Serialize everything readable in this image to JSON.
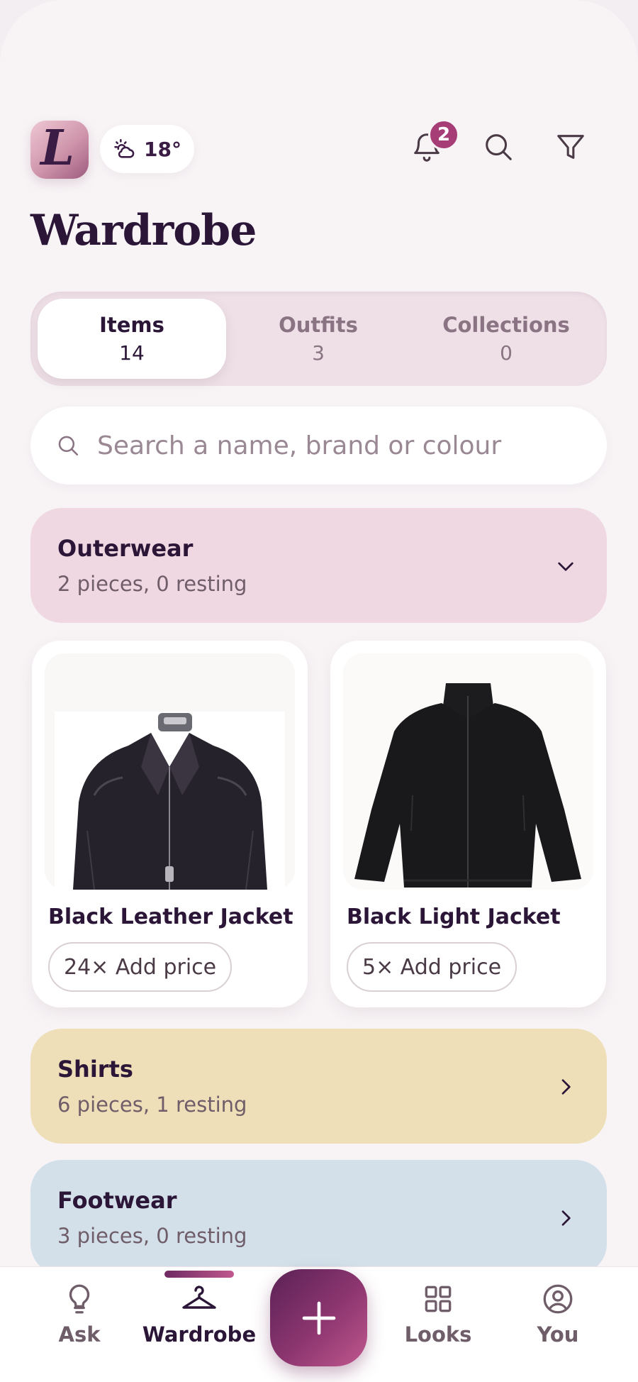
{
  "header": {
    "logo_letter": "L",
    "weather_temp": "18°",
    "weather_icon": "cloud-sun-icon",
    "notification_count": "2"
  },
  "page_title": "Wardrobe",
  "tabs": [
    {
      "label": "Items",
      "count": "14",
      "active": true
    },
    {
      "label": "Outfits",
      "count": "3",
      "active": false
    },
    {
      "label": "Collections",
      "count": "0",
      "active": false
    }
  ],
  "search": {
    "placeholder": "Search a name, brand or colour"
  },
  "categories": [
    {
      "name": "Outerwear",
      "summary": "2 pieces, 0 resting",
      "expanded": true,
      "color": "#f0d8e2"
    },
    {
      "name": "Shirts",
      "summary": "6 pieces, 1 resting",
      "expanded": false,
      "color": "#efdfb8"
    },
    {
      "name": "Footwear",
      "summary": "3 pieces, 0 resting",
      "expanded": false,
      "color": "#d3e0ea"
    }
  ],
  "items": [
    {
      "name": "Black Leather Jacket",
      "price_label": "24× Add price"
    },
    {
      "name": "Black Light Jacket",
      "price_label": "5× Add price"
    }
  ],
  "nav": [
    {
      "label": "Ask",
      "icon": "lightbulb-icon"
    },
    {
      "label": "Wardrobe",
      "icon": "hanger-icon",
      "active": true
    },
    {
      "label": "Add",
      "icon": "plus-icon"
    },
    {
      "label": "Looks",
      "icon": "grid-icon"
    },
    {
      "label": "You",
      "icon": "user-circle-icon"
    }
  ],
  "colors": {
    "accent": "#a63d77",
    "text": "#2b1638",
    "background": "#f8f4f6"
  }
}
